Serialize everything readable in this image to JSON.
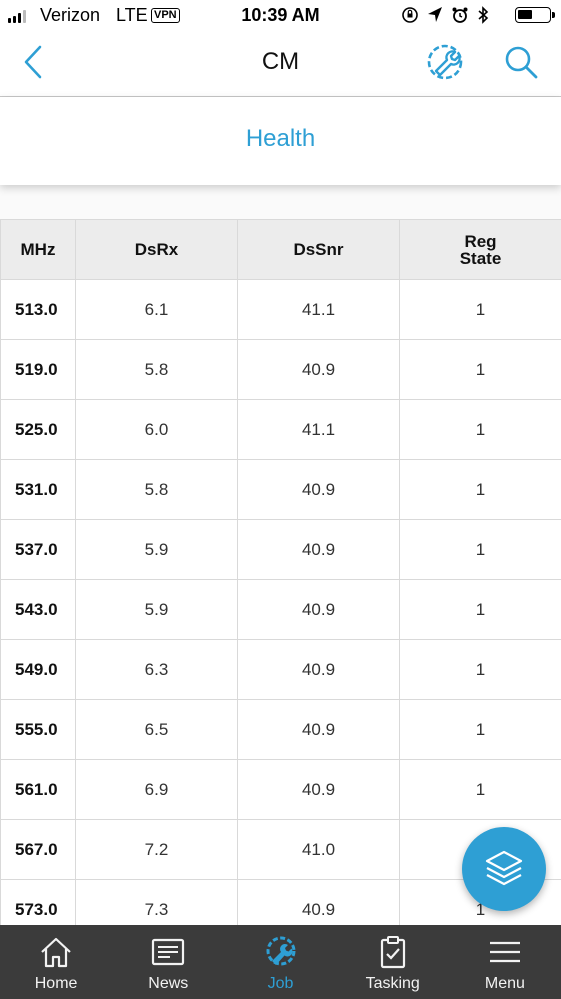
{
  "status_bar": {
    "carrier": "Verizon",
    "network": "LTE",
    "vpn": "VPN",
    "time": "10:39 AM"
  },
  "nav": {
    "title": "CM",
    "back_icon": "chevron-left-icon",
    "tool_icon": "wrench-gear-icon",
    "search_icon": "search-icon"
  },
  "section": {
    "title": "Health"
  },
  "table": {
    "headers": [
      "MHz",
      "DsRx",
      "DsSnr",
      "Reg\nState"
    ],
    "header_reg_line1": "Reg",
    "header_reg_line2": "State",
    "rows": [
      [
        "513.0",
        "6.1",
        "41.1",
        "1"
      ],
      [
        "519.0",
        "5.8",
        "40.9",
        "1"
      ],
      [
        "525.0",
        "6.0",
        "41.1",
        "1"
      ],
      [
        "531.0",
        "5.8",
        "40.9",
        "1"
      ],
      [
        "537.0",
        "5.9",
        "40.9",
        "1"
      ],
      [
        "543.0",
        "5.9",
        "40.9",
        "1"
      ],
      [
        "549.0",
        "6.3",
        "40.9",
        "1"
      ],
      [
        "555.0",
        "6.5",
        "40.9",
        "1"
      ],
      [
        "561.0",
        "6.9",
        "40.9",
        "1"
      ],
      [
        "567.0",
        "7.2",
        "41.0",
        ""
      ],
      [
        "573.0",
        "7.3",
        "40.9",
        "1"
      ]
    ]
  },
  "fab": {
    "icon": "layers-icon"
  },
  "tabs": [
    {
      "label": "Home",
      "icon": "home-icon"
    },
    {
      "label": "News",
      "icon": "news-icon"
    },
    {
      "label": "Job",
      "icon": "job-wrench-icon"
    },
    {
      "label": "Tasking",
      "icon": "clipboard-check-icon"
    },
    {
      "label": "Menu",
      "icon": "hamburger-menu-icon"
    }
  ],
  "colors": {
    "accent": "#2e9fd4",
    "tab_bar_bg": "#3b3b3b",
    "header_row_bg": "#ececec"
  }
}
